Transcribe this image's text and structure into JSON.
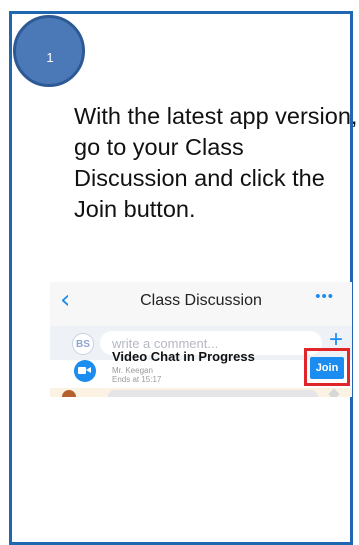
{
  "step": {
    "number": "1"
  },
  "instruction": {
    "text": "With the latest app version, go to your Class Discussion and click the Join button."
  },
  "app": {
    "nav": {
      "back_icon": "chevron-left-icon",
      "title": "Class Discussion",
      "more_icon": "ellipsis-icon"
    },
    "comment": {
      "avatar_initials": "BS",
      "placeholder": "write a comment...",
      "add_icon": "plus-icon"
    },
    "video_chat": {
      "icon": "video-camera-icon",
      "title": "Video Chat in Progress",
      "teacher": "Mr. Keegan",
      "ends": "Ends at 15:17",
      "join_label": "Join"
    }
  },
  "colors": {
    "border": "#1f67b1",
    "badge": "#4b79b8",
    "accent": "#1b8df0",
    "highlight": "#e0252b"
  }
}
